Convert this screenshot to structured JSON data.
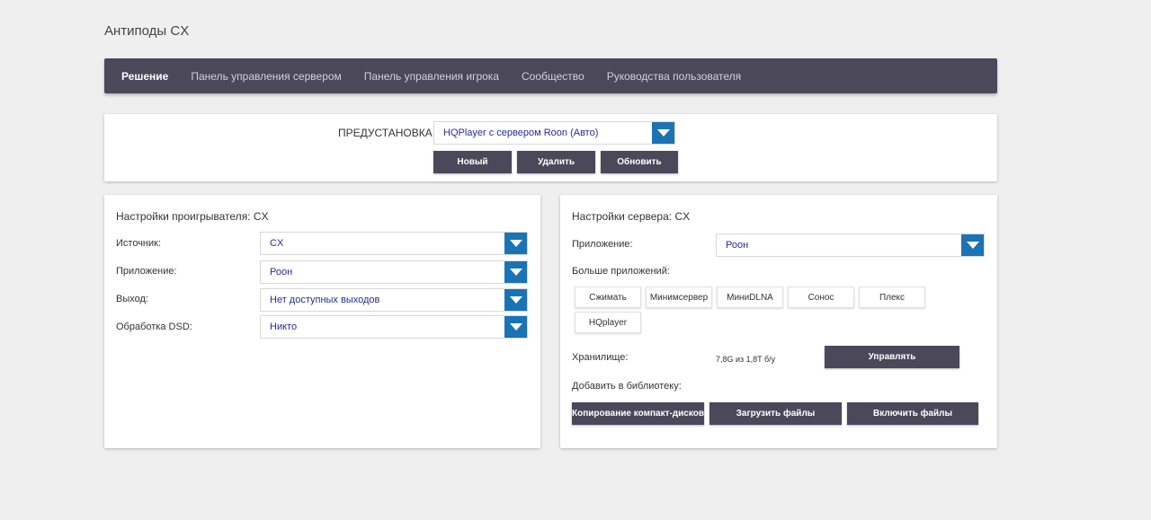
{
  "app": {
    "title": "Антиподы CX"
  },
  "nav": {
    "items": [
      {
        "label": "Решение"
      },
      {
        "label": "Панель управления сервером"
      },
      {
        "label": "Панель управления игрока"
      },
      {
        "label": "Сообщество"
      },
      {
        "label": "Руководства пользователя"
      }
    ]
  },
  "preset": {
    "label": "ПРЕДУСТАНОВКА",
    "selected": "HQPlayer с сервером Roon (Авто)",
    "buttons": {
      "new": "Новый",
      "delete": "Удалить",
      "refresh": "Обновить"
    }
  },
  "player": {
    "title": "Настройки проигрывателя: CX",
    "fields": [
      {
        "label": "Источник:",
        "value": "CX"
      },
      {
        "label": "Приложение:",
        "value": "Роон"
      },
      {
        "label": "Выход:",
        "value": "Нет доступных выходов"
      },
      {
        "label": "Обработка DSD:",
        "value": "Никто"
      }
    ]
  },
  "server": {
    "title": "Настройки сервера: CX",
    "app_label": "Приложение:",
    "app_value": "Роон",
    "more_apps_label": "Больше приложений:",
    "more_apps": [
      "Сжимать",
      "Минимсервер",
      "МиниDLNA",
      "Сонос",
      "Плекс",
      "HQplayer"
    ],
    "storage_label": "Хранилище:",
    "storage_value": "7,8G из 1,8T б/у",
    "manage_button": "Управлять",
    "add_library_label": "Добавить в библиотеку:",
    "library_buttons": [
      "Копирование компакт-дисков",
      "Загрузить файлы",
      "Включить файлы"
    ]
  },
  "colors": {
    "accent": "#1a73b5",
    "nav_bg": "#4a4859",
    "page_bg": "#efefef"
  }
}
